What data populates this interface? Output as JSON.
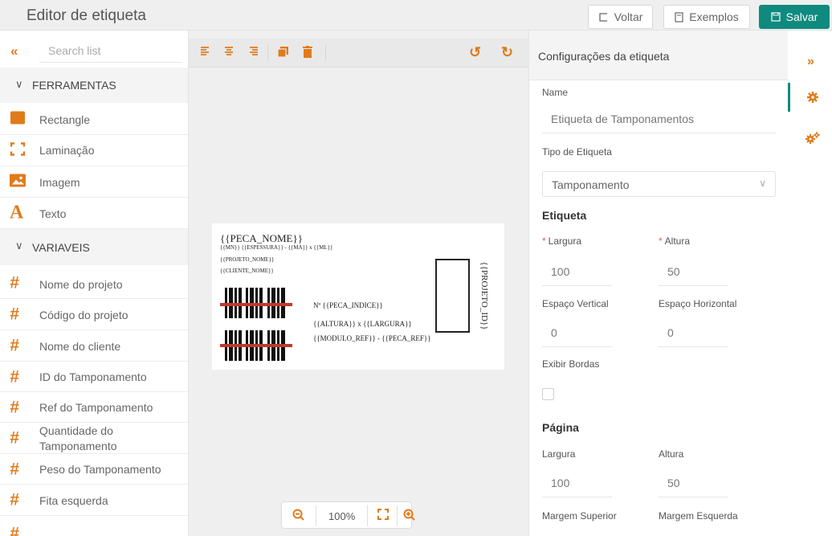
{
  "header": {
    "title": "Editor de etiqueta",
    "back_label": "Voltar",
    "examples_label": "Exemplos",
    "save_label": "Salvar"
  },
  "sidebar": {
    "search_placeholder": "Search list",
    "sections": [
      {
        "label": "FERRAMENTAS"
      },
      {
        "label": "VARIAVEIS"
      }
    ],
    "tools": [
      {
        "label": "Rectangle",
        "icon": "square-icon"
      },
      {
        "label": "Laminação",
        "icon": "corners-icon"
      },
      {
        "label": "Imagem",
        "icon": "image-icon"
      },
      {
        "label": "Texto",
        "icon": "letter-a-icon"
      }
    ],
    "variables": [
      {
        "label": "Nome do projeto"
      },
      {
        "label": "Código do projeto"
      },
      {
        "label": "Nome do cliente"
      },
      {
        "label": "ID do Tamponamento"
      },
      {
        "label": "Ref do Tamponamento"
      },
      {
        "label": "Quantidade do Tamponamento"
      },
      {
        "label": "Peso do Tamponamento"
      },
      {
        "label": "Fita esquerda"
      }
    ]
  },
  "label_preview": {
    "peca_nome": "{{PECA_NOME}}",
    "line_dims": "{{MN}} {{ESPESSURA}} - {{MA}} x {{ML}}",
    "projeto_nome": "{{PROJETO_NOME}}",
    "cliente_nome": "{{CLIENTE_NOME}}",
    "peca_indice": "Nº {{PECA_INDICE}}",
    "altura_largura": "{{ALTURA}} x {{LARGURA}}",
    "modulo_ref": "{{MODULO_REF}} - {{PECA_REF}}",
    "projeto_id": "{{PROJETO_ID}}"
  },
  "zoom": {
    "value": "100%"
  },
  "config": {
    "title": "Configurações da etiqueta",
    "name_label": "Name",
    "name_value": "Etiqueta de Tamponamentos",
    "tipo_label": "Tipo de Etiqueta",
    "tipo_value": "Tamponamento",
    "etiqueta_heading": "Etiqueta",
    "largura_label": "Largura",
    "largura_value": "100",
    "altura_label": "Altura",
    "altura_value": "50",
    "espaco_v_label": "Espaço Vertical",
    "espaco_v_value": "0",
    "espaco_h_label": "Espaço Horizontal",
    "espaco_h_value": "0",
    "bordas_label": "Exibir Bordas",
    "pagina_heading": "Página",
    "pag_largura_label": "Largura",
    "pag_largura_value": "100",
    "pag_altura_label": "Altura",
    "pag_altura_value": "50",
    "margem_sup_label": "Margem Superior",
    "margem_esq_label": "Margem Esquerda"
  },
  "colors": {
    "accent": "#e07b1a",
    "primary": "#0f8a7e"
  }
}
